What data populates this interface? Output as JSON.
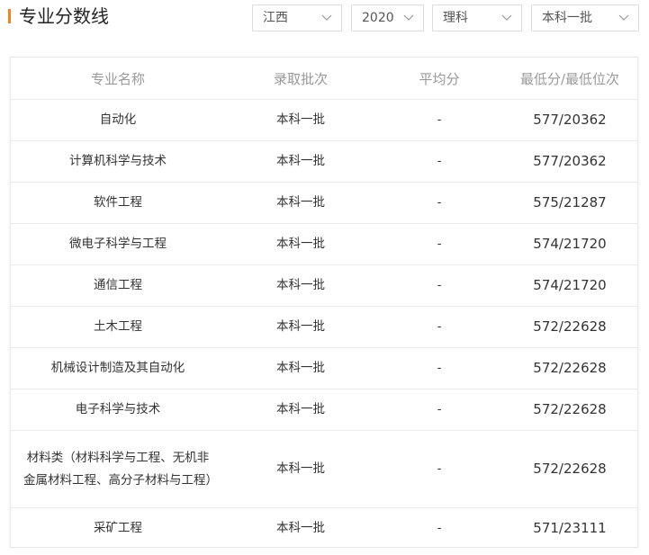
{
  "header": {
    "title": "专业分数线",
    "filters": {
      "province": "江西",
      "year": "2020",
      "subject": "理科",
      "batch": "本科一批"
    },
    "accent_color": "#f7821b"
  },
  "table": {
    "columns": [
      "专业名称",
      "录取批次",
      "平均分",
      "最低分/最低位次"
    ],
    "rows": [
      {
        "name": "自动化",
        "batch": "本科一批",
        "avg": "-",
        "min": "577/20362"
      },
      {
        "name": "计算机科学与技术",
        "batch": "本科一批",
        "avg": "-",
        "min": "577/20362"
      },
      {
        "name": "软件工程",
        "batch": "本科一批",
        "avg": "-",
        "min": "575/21287"
      },
      {
        "name": "微电子科学与工程",
        "batch": "本科一批",
        "avg": "-",
        "min": "574/21720"
      },
      {
        "name": "通信工程",
        "batch": "本科一批",
        "avg": "-",
        "min": "574/21720"
      },
      {
        "name": "土木工程",
        "batch": "本科一批",
        "avg": "-",
        "min": "572/22628"
      },
      {
        "name": "机械设计制造及其自动化",
        "batch": "本科一批",
        "avg": "-",
        "min": "572/22628"
      },
      {
        "name": "电子科学与技术",
        "batch": "本科一批",
        "avg": "-",
        "min": "572/22628"
      },
      {
        "name": "材料类（材料科学与工程、无机非金属材料工程、高分子材料与工程）",
        "batch": "本科一批",
        "avg": "-",
        "min": "572/22628"
      },
      {
        "name": "采矿工程",
        "batch": "本科一批",
        "avg": "-",
        "min": "571/23111"
      }
    ]
  }
}
